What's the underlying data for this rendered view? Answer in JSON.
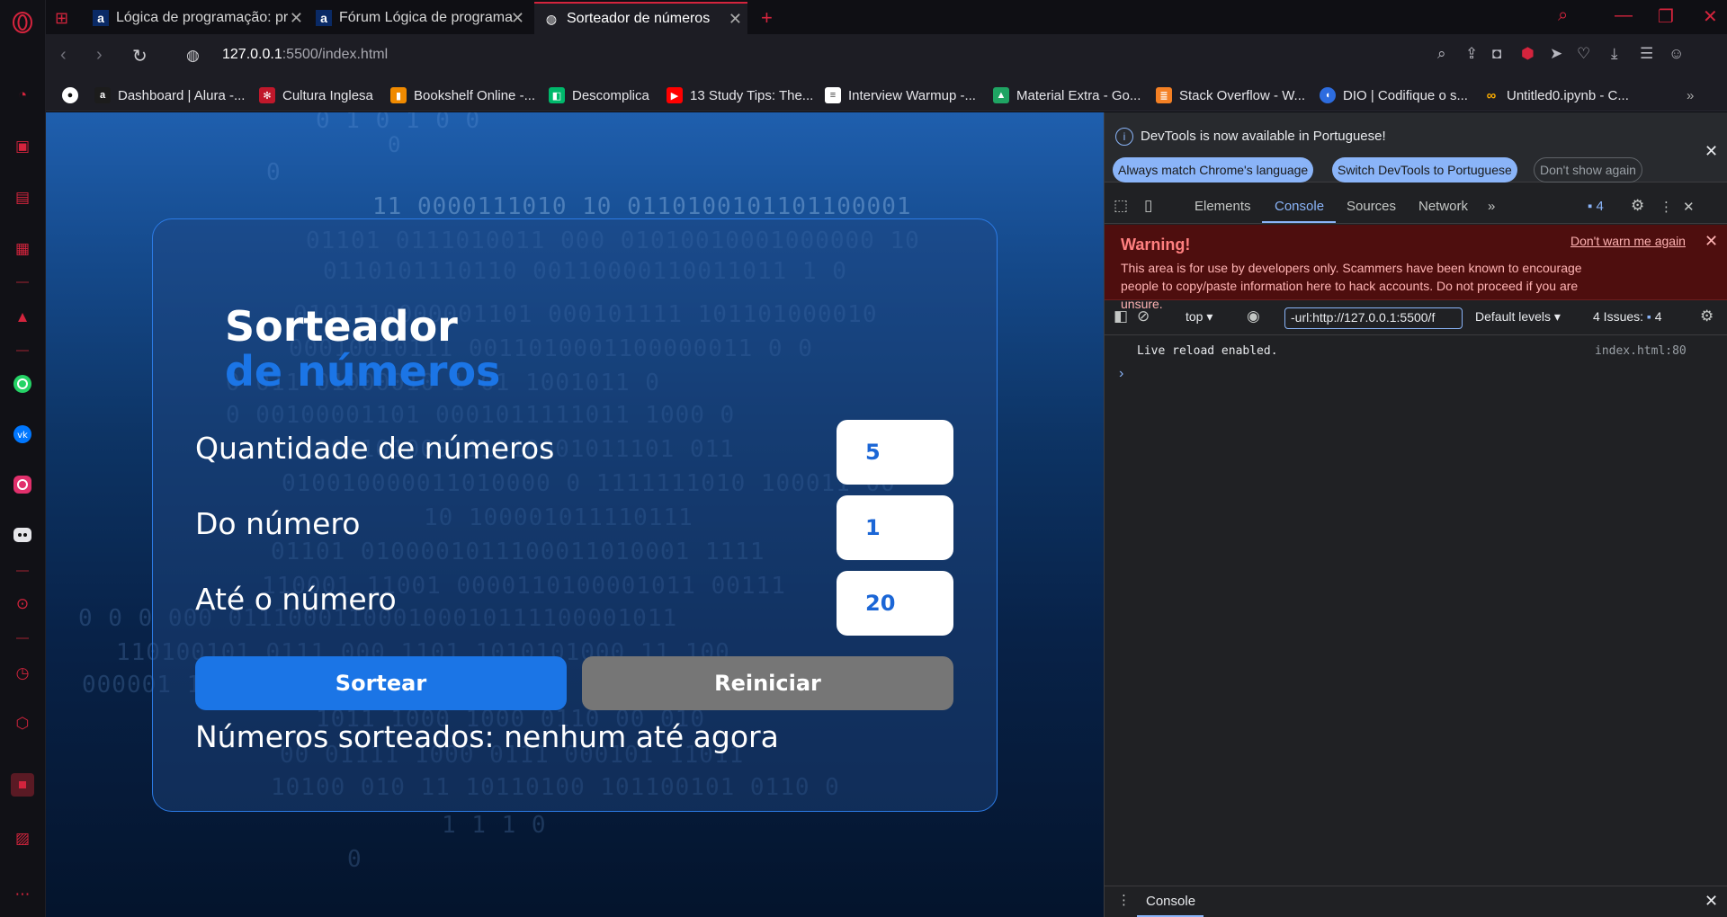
{
  "browser": {
    "tabs": [
      {
        "title": "Lógica de programação: pr",
        "favicon": "alura-icon",
        "active": false
      },
      {
        "title": "Fórum Lógica de programa",
        "favicon": "alura-icon",
        "active": false
      },
      {
        "title": "Sorteador de números",
        "favicon": "globe-icon",
        "active": true
      }
    ],
    "new_tab": "+",
    "url_host": "127.0.0.1",
    "url_path": ":5500/index.html",
    "bookmarks": [
      {
        "label": "",
        "icon": "github-icon",
        "color": "#ffffff"
      },
      {
        "label": "Dashboard | Alura -...",
        "icon": "alura-icon",
        "color": "#1c1c1c"
      },
      {
        "label": "Cultura Inglesa",
        "icon": "cultura-icon",
        "color": "#c0182b"
      },
      {
        "label": "Bookshelf Online -...",
        "icon": "bookshelf-icon",
        "color": "#f08a00"
      },
      {
        "label": "Descomplica",
        "icon": "descomplica-icon",
        "color": "#00b86b"
      },
      {
        "label": "13 Study Tips: The...",
        "icon": "youtube-icon",
        "color": "#ff0000"
      },
      {
        "label": "Interview Warmup -...",
        "icon": "google-icon",
        "color": "#ffffff"
      },
      {
        "label": "Material Extra - Go...",
        "icon": "drive-icon",
        "color": "#1fa463"
      },
      {
        "label": "Stack Overflow - W...",
        "icon": "stackoverflow-icon",
        "color": "#f48024"
      },
      {
        "label": "DIO | Codifique o s...",
        "icon": "dio-icon",
        "color": "#2d6cdf"
      },
      {
        "label": "Untitled0.ipynb - C...",
        "icon": "colab-icon",
        "color": "#f9ab00"
      }
    ],
    "accent": "#d4243d"
  },
  "app": {
    "title_line1": "Sorteador",
    "title_line2": "de números",
    "fields": [
      {
        "label": "Quantidade de números",
        "value": "5"
      },
      {
        "label": "Do número",
        "value": "1"
      },
      {
        "label": "Até o número",
        "value": "20"
      }
    ],
    "draw_button": "Sortear",
    "reset_button": "Reiniciar",
    "result_text": "Números sorteados: nenhum até agora",
    "accent": "#1b75e6"
  },
  "devtools": {
    "info_message": "DevTools is now available in Portuguese!",
    "btn_match": "Always match Chrome's language",
    "btn_switch": "Switch DevTools to Portuguese",
    "btn_dont_show": "Don't show again",
    "tabs": [
      "Elements",
      "Console",
      "Sources",
      "Network"
    ],
    "active_tab": "Console",
    "issues_badge": "4",
    "warning_title": "Warning!",
    "warning_body": "This area is for use by developers only. Scammers have been known to encourage people to copy/paste information here to hack accounts. Do not proceed if you are unsure.",
    "dont_warn": "Don't warn me again",
    "context": "top",
    "filter_value": "-url:http://127.0.0.1:5500/f",
    "levels": "Default levels",
    "issues_label": "4 Issues:",
    "issues_count": "4",
    "log_message": "Live reload enabled.",
    "log_source": "index.html:80",
    "drawer_tab": "Console"
  }
}
